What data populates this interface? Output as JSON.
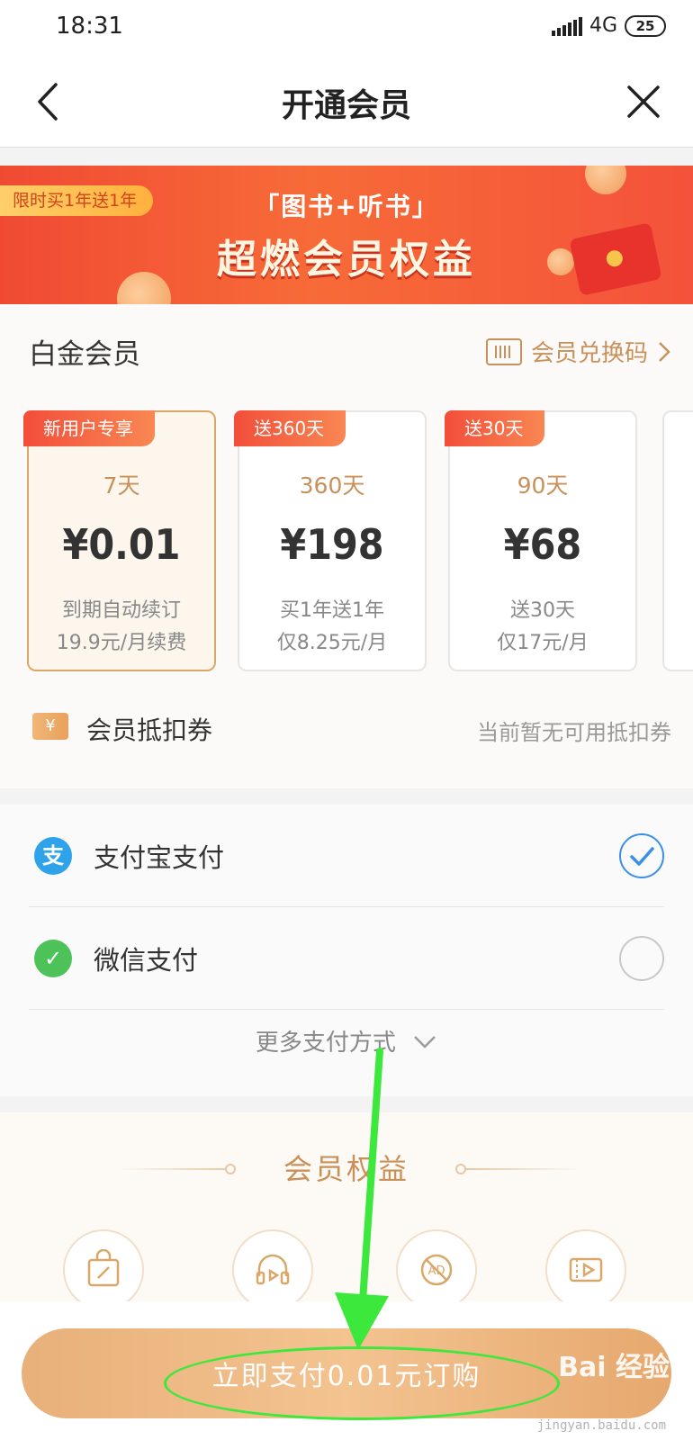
{
  "status_bar": {
    "time": "18:31",
    "network": "4G",
    "battery": "25"
  },
  "nav": {
    "title": "开通会员",
    "back_icon": "chevron-left-icon",
    "close_icon": "close-icon"
  },
  "banner": {
    "tag": "限时买1年送1年",
    "subtitle": "「图书+听书」",
    "title": "超燃会员权益"
  },
  "membership": {
    "title": "白金会员",
    "redeem_label": "会员兑换码",
    "plans": [
      {
        "badge": "新用户专享",
        "days": "7天",
        "price": "¥0.01",
        "note1": "到期自动续订",
        "note2": "19.9元/月续费",
        "selected": true
      },
      {
        "badge": "送360天",
        "days": "360天",
        "price": "¥198",
        "note1": "买1年送1年",
        "note2": "仅8.25元/月",
        "selected": false
      },
      {
        "badge": "送30天",
        "days": "90天",
        "price": "¥68",
        "note1": "送30天",
        "note2": "仅17元/月",
        "selected": false
      }
    ],
    "coupon": {
      "icon_text": "¥",
      "label": "会员抵扣券",
      "status": "当前暂无可用抵扣券"
    }
  },
  "payment": {
    "options": [
      {
        "icon_text": "支",
        "label": "支付宝支付",
        "icon_color": "#2fa3e9",
        "checked": true
      },
      {
        "icon_text": "✓",
        "label": "微信支付",
        "icon_color": "#4cc258",
        "checked": false
      }
    ],
    "more_label": "更多支付方式"
  },
  "benefits": {
    "title": "会员权益",
    "icons": [
      "discount-bag-icon",
      "audiobook-headphones-icon",
      "no-ads-icon",
      "video-ticket-icon"
    ]
  },
  "checkout": {
    "button_label": "立即支付0.01元订购"
  },
  "watermark": {
    "logo": "Bai 经验",
    "url": "jingyan.baidu.com"
  },
  "colors": {
    "accent_gold": "#c9915a",
    "banner_red": "#f04a33",
    "checked_blue": "#3a8fe8",
    "annotation_green": "#3ce83c"
  }
}
